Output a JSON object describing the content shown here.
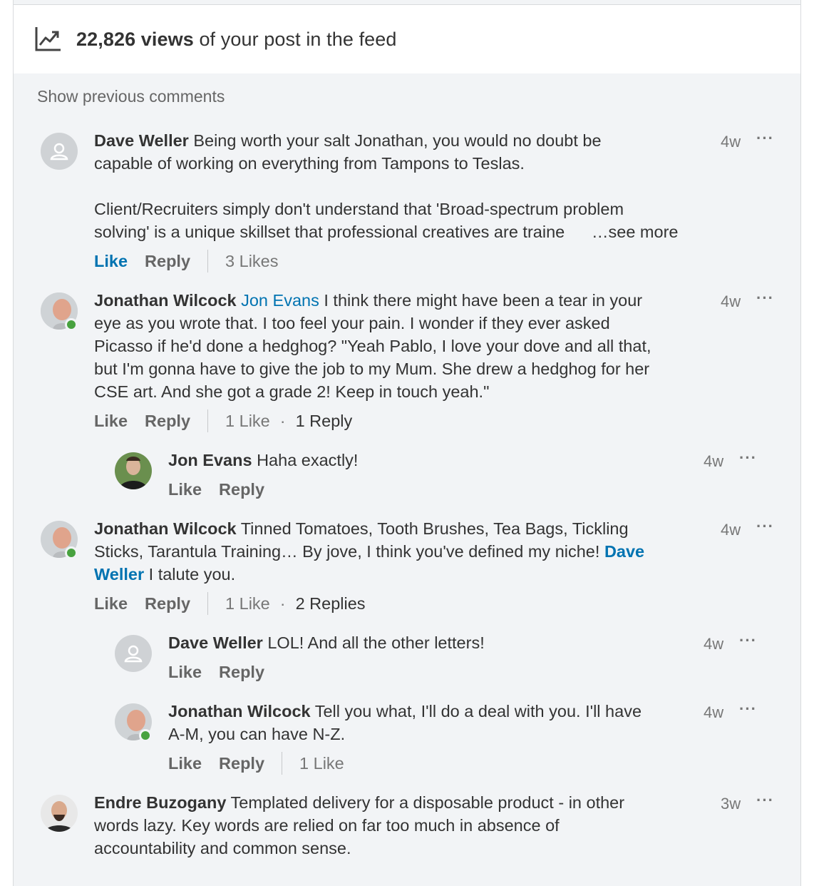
{
  "views": {
    "count": "22,826 views",
    "suffix": " of your post in the feed"
  },
  "show_previous": "Show previous comments",
  "comments": [
    {
      "author": "Dave Weller",
      "text1": "Being worth your salt Jonathan, you would no doubt be",
      "text2": "capable of working on everything from Tampons to Teslas.",
      "text3": "Client/Recruiters simply don't understand that 'Broad-spectrum problem",
      "text4": "solving' is a unique skillset that professional creatives are traine",
      "see_more": "…see more",
      "time": "4w",
      "like": "Like",
      "reply": "Reply",
      "likes": "3 Likes"
    },
    {
      "author": "Jonathan Wilcock",
      "mention": "Jon Evans",
      "text1": " I think there might have been a tear in your",
      "text2": "eye as you wrote that. I too feel your pain. I wonder if they ever asked",
      "text3": "Picasso if he'd done a hedghog? \"Yeah Pablo, I love your dove and all that,",
      "text4": "but I'm gonna have to give the job to my Mum. She drew a hedghog for her",
      "text5": "CSE art. And she got a grade 2! Keep in touch yeah.\"",
      "time": "4w",
      "like": "Like",
      "reply": "Reply",
      "likes": "1 Like",
      "replies": "1 Reply"
    },
    {
      "author": "Jon Evans",
      "text1": "Haha exactly!",
      "time": "4w",
      "like": "Like",
      "reply": "Reply"
    },
    {
      "author": "Jonathan Wilcock",
      "text1": "Tinned Tomatoes, Tooth Brushes, Tea Bags, Tickling",
      "text2": "Sticks, Tarantula Training… By jove, I think you've defined my niche!",
      "mention_a": "Dave",
      "mention_b": "Weller",
      "text3": " I talute you.",
      "time": "4w",
      "like": "Like",
      "reply": "Reply",
      "likes": "1 Like",
      "replies": "2 Replies"
    },
    {
      "author": "Dave Weller",
      "text1": "LOL! And all the other letters!",
      "time": "4w",
      "like": "Like",
      "reply": "Reply"
    },
    {
      "author": "Jonathan Wilcock",
      "text1": "Tell you what, I'll do a deal with you. I'll have",
      "text2": "A-M, you can have N-Z.",
      "time": "4w",
      "like": "Like",
      "reply": "Reply",
      "likes": "1 Like"
    },
    {
      "author": "Endre Buzogany",
      "text1": "Templated delivery for a disposable product - in other",
      "text2": "words lazy. Key words are relied on far too much in absence of",
      "text3": "accountability and common sense.",
      "time": "3w"
    }
  ],
  "more_label": "···",
  "colors": {
    "accent": "#0073b1",
    "online": "#48a23f",
    "background": "#f2f4f6"
  },
  "icons": [
    "trending-up-icon",
    "ghost-avatar-icon",
    "more-options-icon"
  ]
}
